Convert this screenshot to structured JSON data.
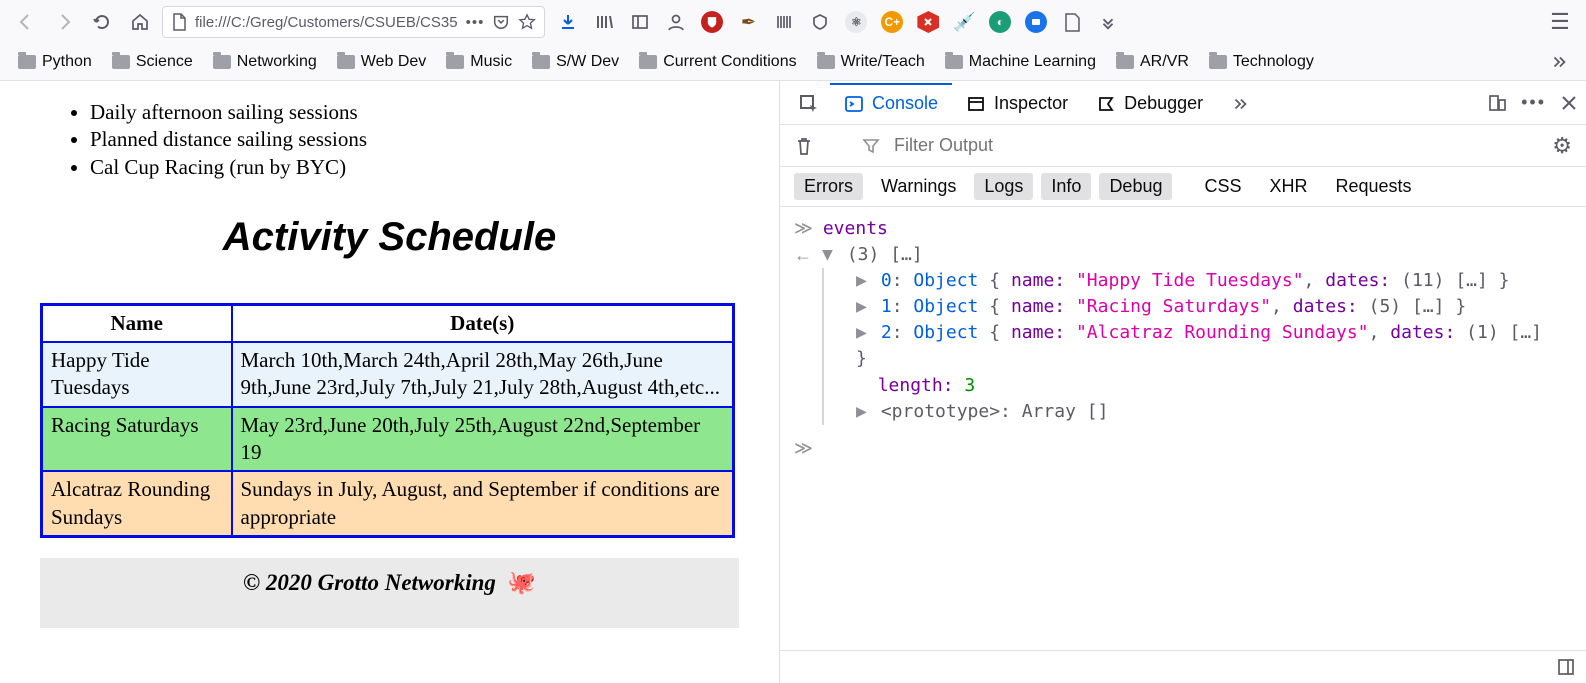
{
  "url_bar": {
    "text": "file:///C:/Greg/Customers/CSUEB/CS35"
  },
  "bookmarks": {
    "items": [
      {
        "label": "Python"
      },
      {
        "label": "Science"
      },
      {
        "label": "Networking"
      },
      {
        "label": "Web Dev"
      },
      {
        "label": "Music"
      },
      {
        "label": "S/W Dev"
      },
      {
        "label": "Current Conditions"
      },
      {
        "label": "Write/Teach"
      },
      {
        "label": "Machine Learning"
      },
      {
        "label": "AR/VR"
      },
      {
        "label": "Technology"
      }
    ]
  },
  "page": {
    "bullets": [
      "Daily afternoon sailing sessions",
      "Planned distance sailing sessions",
      "Cal Cup Racing (run by BYC)"
    ],
    "heading": "Activity Schedule",
    "table": {
      "headers": {
        "name": "Name",
        "dates": "Date(s)"
      },
      "rows": [
        {
          "name": "Happy Tide Tuesdays",
          "dates": "March 10th,March 24th,April 28th,May 26th,June 9th,June 23rd,July 7th,July 21,July 28th,August 4th,etc..."
        },
        {
          "name": "Racing Saturdays",
          "dates": "May 23rd,June 20th,July 25th,August 22nd,September 19"
        },
        {
          "name": "Alcatraz Rounding Sundays",
          "dates": "Sundays in July, August, and September if conditions are appropriate"
        }
      ]
    },
    "footer": {
      "text": "© 2020 Grotto Networking",
      "emoji": "🐙"
    }
  },
  "devtools": {
    "tabs": {
      "console": "Console",
      "inspector": "Inspector",
      "debugger": "Debugger"
    },
    "filter_placeholder": "Filter Output",
    "cats": {
      "errors": "Errors",
      "warnings": "Warnings",
      "logs": "Logs",
      "info": "Info",
      "debug": "Debug",
      "css": "CSS",
      "xhr": "XHR",
      "requests": "Requests"
    },
    "input": "events",
    "out": {
      "count": "(3)",
      "ellips": "[…]",
      "items": [
        {
          "idx": "0",
          "name": "\"Happy Tide Tuesdays\"",
          "dates_n": "(11)",
          "more": "[…]"
        },
        {
          "idx": "1",
          "name": "\"Racing Saturdays\"",
          "dates_n": "(5)",
          "more": "[…]"
        },
        {
          "idx": "2",
          "name": "\"Alcatraz Rounding Sundays\"",
          "dates_n": "(1)",
          "more": "[…]"
        }
      ],
      "length_label": "length:",
      "length": "3",
      "proto": "<prototype>: Array []"
    }
  },
  "labels": {
    "object": "Object",
    "name_key": "name:",
    "dates_key": "dates:",
    "brace_open": "{",
    "brace_close": "}"
  }
}
